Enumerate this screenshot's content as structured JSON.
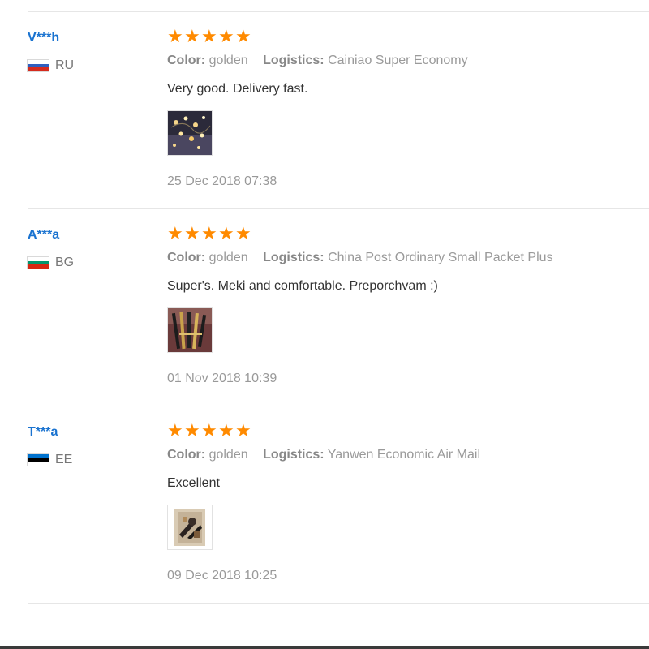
{
  "reviews": [
    {
      "user": "V***h",
      "country": "RU",
      "flag_colors": [
        "#ffffff",
        "#2f5fbf",
        "#d52b1e"
      ],
      "rating_stars": 5,
      "color_label": "Color:",
      "color_value": "golden",
      "logistics_label": "Logistics:",
      "logistics_value": "Cainiao Super Economy",
      "comment": "Very good. Delivery fast.",
      "photo_icon": "review-photo-fairy-lights",
      "date": "25 Dec 2018 07:38"
    },
    {
      "user": "A***a",
      "country": "BG",
      "flag_colors": [
        "#ffffff",
        "#00966e",
        "#d62612"
      ],
      "rating_stars": 5,
      "color_label": "Color:",
      "color_value": "golden",
      "logistics_label": "Logistics:",
      "logistics_value": "China Post Ordinary Small Packet Plus",
      "comment": "Super's. Meki and comfortable. Preporchvam :)",
      "photo_icon": "review-photo-brushes",
      "date": "01 Nov 2018 10:39"
    },
    {
      "user": "T***a",
      "country": "EE",
      "flag_colors": [
        "#0072ce",
        "#000000",
        "#ffffff"
      ],
      "rating_stars": 5,
      "color_label": "Color:",
      "color_value": "golden",
      "logistics_label": "Logistics:",
      "logistics_value": "Yanwen Economic Air Mail",
      "comment": "Excellent",
      "photo_icon": "review-photo-brush-set",
      "date": "09 Dec 2018 10:25"
    }
  ],
  "colors": {
    "star": "#ff8a00",
    "username": "#1a73d0",
    "divider": "#e6e6e6"
  }
}
